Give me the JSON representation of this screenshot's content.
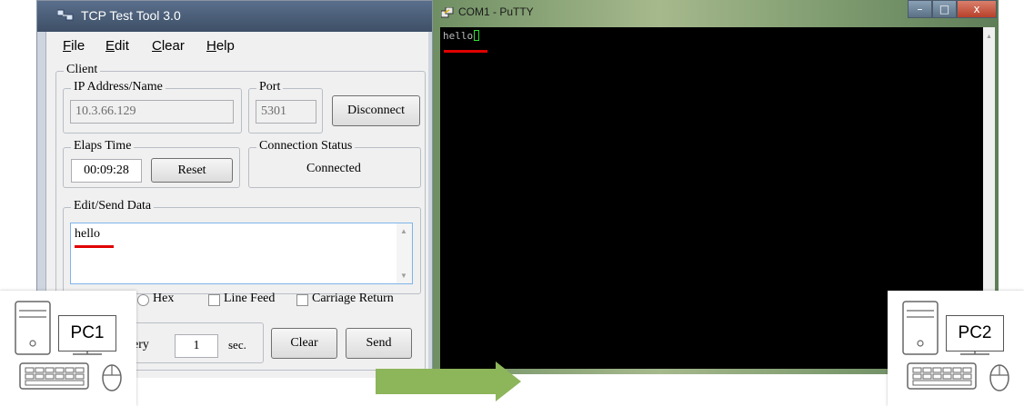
{
  "tcp_tool": {
    "title": "TCP Test Tool 3.0",
    "menu": [
      {
        "key": "F",
        "rest": "ile"
      },
      {
        "key": "E",
        "rest": "dit"
      },
      {
        "key": "C",
        "rest": "lear"
      },
      {
        "key": "H",
        "rest": "elp"
      }
    ],
    "client_group": "Client",
    "ip_group": "IP Address/Name",
    "ip_value": "10.3.66.129",
    "port_group": "Port",
    "port_value": "5301",
    "disconnect_label": "Disconnect",
    "elaps_group": "Elaps Time",
    "elaps_value": "00:09:28",
    "reset_label": "Reset",
    "conn_group": "Connection Status",
    "conn_value": "Connected",
    "edit_group": "Edit/Send Data",
    "send_text": "hello",
    "hex_label": "Hex",
    "line_feed_label": "Line Feed",
    "carriage_return_label": "Carriage Return",
    "every_label": "ery",
    "interval_value": "1",
    "sec_label": "sec.",
    "clear_label": "Clear",
    "send_label": "Send"
  },
  "putty": {
    "title": "COM1 - PuTTY",
    "terminal_text": "hello",
    "buttons": {
      "minimize": "–",
      "maximize": "□",
      "close": "x"
    }
  },
  "pc1": {
    "label": "PC1"
  },
  "pc2": {
    "label": "PC2"
  },
  "colors": {
    "highlight": "#e00000",
    "arrow": "#8db55a"
  }
}
